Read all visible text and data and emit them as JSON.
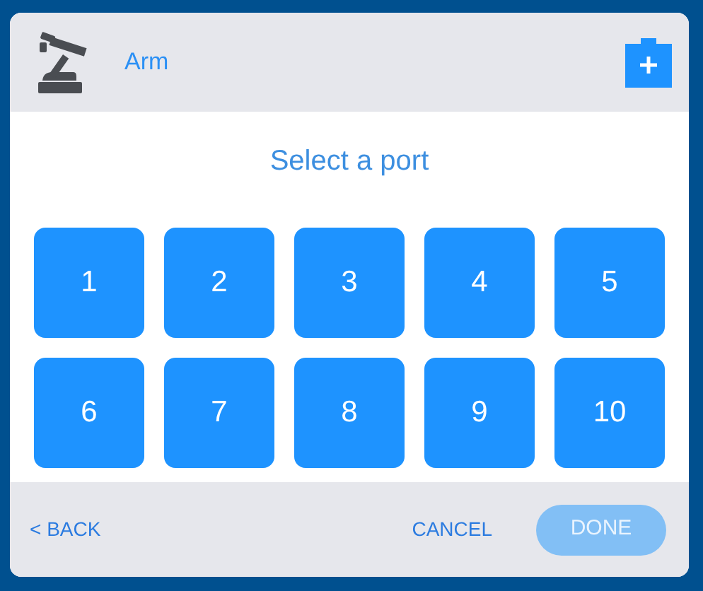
{
  "header": {
    "title": "Arm"
  },
  "prompt": "Select a port",
  "ports": [
    {
      "label": "1"
    },
    {
      "label": "2"
    },
    {
      "label": "3"
    },
    {
      "label": "4"
    },
    {
      "label": "5"
    },
    {
      "label": "6"
    },
    {
      "label": "7"
    },
    {
      "label": "8"
    },
    {
      "label": "9"
    },
    {
      "label": "10"
    }
  ],
  "footer": {
    "back": "< BACK",
    "cancel": "CANCEL",
    "done": {
      "label": "DONE",
      "disabled": true
    }
  }
}
